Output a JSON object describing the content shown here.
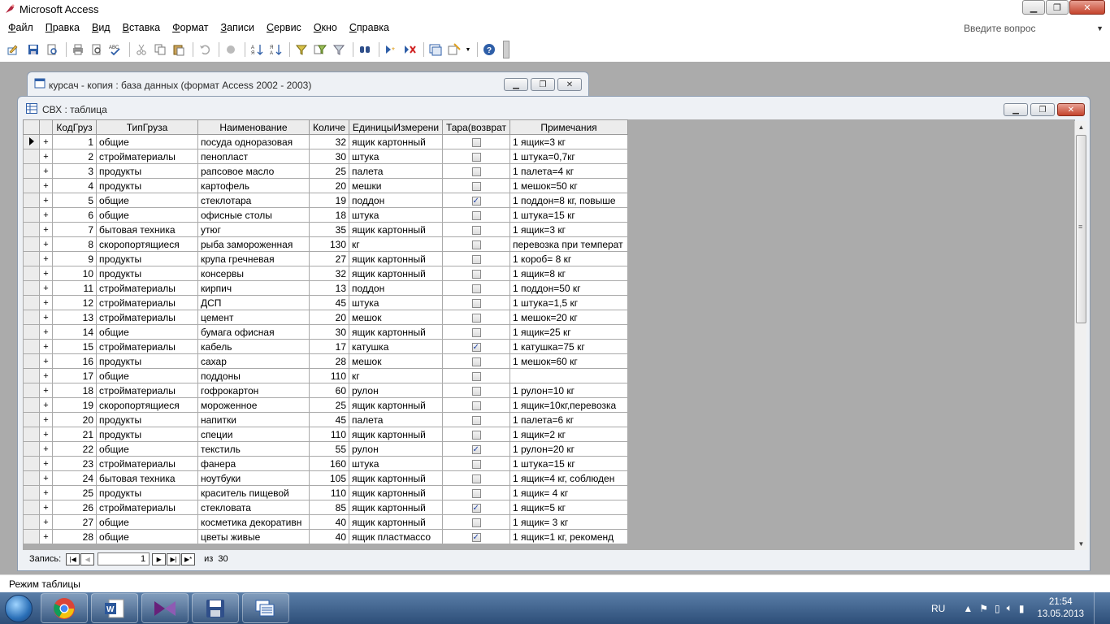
{
  "app": {
    "title": "Microsoft Access"
  },
  "menu": [
    "Файл",
    "Правка",
    "Вид",
    "Вставка",
    "Формат",
    "Записи",
    "Сервис",
    "Окно",
    "Справка"
  ],
  "ask": {
    "placeholder": "Введите вопрос"
  },
  "db_window": {
    "title": "курсач - копия : база данных (формат Access 2002 - 2003)"
  },
  "table_window": {
    "title": "СВХ : таблица"
  },
  "columns": [
    "КодГруз",
    "ТипГруза",
    "Наименование",
    "Количе",
    "ЕдиницыИзмерени",
    "Тара(возврат",
    "Примечания"
  ],
  "rows": [
    {
      "id": "1",
      "type": "общие",
      "name": "посуда одноразовая",
      "qty": "32",
      "unit": "ящик картонный",
      "tara": false,
      "note": "1 ящик=3 кг"
    },
    {
      "id": "2",
      "type": "стройматериалы",
      "name": "пенопласт",
      "qty": "30",
      "unit": "штука",
      "tara": false,
      "note": "1 штука=0,7кг"
    },
    {
      "id": "3",
      "type": "продукты",
      "name": "рапсовое масло",
      "qty": "25",
      "unit": "палета",
      "tara": false,
      "note": "1 палета=4 кг"
    },
    {
      "id": "4",
      "type": "продукты",
      "name": "картофель",
      "qty": "20",
      "unit": "мешки",
      "tara": false,
      "note": "1 мешок=50 кг"
    },
    {
      "id": "5",
      "type": "общие",
      "name": "стеклотара",
      "qty": "19",
      "unit": "поддон",
      "tara": true,
      "note": "1 поддон=8 кг, повыше"
    },
    {
      "id": "6",
      "type": "общие",
      "name": "офисные столы",
      "qty": "18",
      "unit": "штука",
      "tara": false,
      "note": "1 штука=15 кг"
    },
    {
      "id": "7",
      "type": "бытовая техника",
      "name": "утюг",
      "qty": "35",
      "unit": "ящик картонный",
      "tara": false,
      "note": "1 ящик=3 кг"
    },
    {
      "id": "8",
      "type": "скоропортящиеся",
      "name": "рыба замороженная",
      "qty": "130",
      "unit": "кг",
      "tara": false,
      "note": "перевозка при температ"
    },
    {
      "id": "9",
      "type": "продукты",
      "name": "крупа гречневая",
      "qty": "27",
      "unit": "ящик картонный",
      "tara": false,
      "note": "1 короб= 8 кг"
    },
    {
      "id": "10",
      "type": "продукты",
      "name": "консервы",
      "qty": "32",
      "unit": "ящик картонный",
      "tara": false,
      "note": "1 ящик=8 кг"
    },
    {
      "id": "11",
      "type": "стройматериалы",
      "name": "кирпич",
      "qty": "13",
      "unit": "поддон",
      "tara": false,
      "note": "1 поддон=50 кг"
    },
    {
      "id": "12",
      "type": "стройматериалы",
      "name": "ДСП",
      "qty": "45",
      "unit": "штука",
      "tara": false,
      "note": "1 штука=1,5 кг"
    },
    {
      "id": "13",
      "type": "стройматериалы",
      "name": "цемент",
      "qty": "20",
      "unit": "мешок",
      "tara": false,
      "note": "1 мешок=20 кг"
    },
    {
      "id": "14",
      "type": "общие",
      "name": "бумага офисная",
      "qty": "30",
      "unit": "ящик картонный",
      "tara": false,
      "note": "1 ящик=25 кг"
    },
    {
      "id": "15",
      "type": "стройматериалы",
      "name": "кабель",
      "qty": "17",
      "unit": "катушка",
      "tara": true,
      "note": "1 катушка=75 кг"
    },
    {
      "id": "16",
      "type": "продукты",
      "name": "сахар",
      "qty": "28",
      "unit": "мешок",
      "tara": false,
      "note": "1 мешок=60 кг"
    },
    {
      "id": "17",
      "type": "общие",
      "name": "поддоны",
      "qty": "110",
      "unit": "кг",
      "tara": false,
      "note": ""
    },
    {
      "id": "18",
      "type": "стройматериалы",
      "name": "гофрокартон",
      "qty": "60",
      "unit": "рулон",
      "tara": false,
      "note": "1 рулон=10 кг"
    },
    {
      "id": "19",
      "type": "скоропортящиеся",
      "name": "мороженное",
      "qty": "25",
      "unit": "ящик картонный",
      "tara": false,
      "note": "1 ящик=10кг,перевозка"
    },
    {
      "id": "20",
      "type": "продукты",
      "name": "напитки",
      "qty": "45",
      "unit": "палета",
      "tara": false,
      "note": "1 палета=6 кг"
    },
    {
      "id": "21",
      "type": "продукты",
      "name": "специи",
      "qty": "110",
      "unit": "ящик картонный",
      "tara": false,
      "note": "1 ящик=2 кг"
    },
    {
      "id": "22",
      "type": "общие",
      "name": "текстиль",
      "qty": "55",
      "unit": "рулон",
      "tara": true,
      "note": "1 рулон=20 кг"
    },
    {
      "id": "23",
      "type": "стройматериалы",
      "name": "фанера",
      "qty": "160",
      "unit": "штука",
      "tara": false,
      "note": "1 штука=15 кг"
    },
    {
      "id": "24",
      "type": "бытовая техника",
      "name": "ноутбуки",
      "qty": "105",
      "unit": "ящик картонный",
      "tara": false,
      "note": "1 ящик=4 кг, соблюден"
    },
    {
      "id": "25",
      "type": "продукты",
      "name": "краситель пищевой",
      "qty": "110",
      "unit": "ящик картонный",
      "tara": false,
      "note": "1 ящик= 4 кг"
    },
    {
      "id": "26",
      "type": "стройматериалы",
      "name": "стекловата",
      "qty": "85",
      "unit": "ящик картонный",
      "tara": true,
      "note": "1 ящик=5 кг"
    },
    {
      "id": "27",
      "type": "общие",
      "name": "косметика декоративн",
      "qty": "40",
      "unit": "ящик картонный",
      "tara": false,
      "note": "1 ящик= 3 кг"
    },
    {
      "id": "28",
      "type": "общие",
      "name": "цветы живые",
      "qty": "40",
      "unit": "ящик пластмассо",
      "tara": true,
      "note": "1 ящик=1 кг, рекоменд"
    }
  ],
  "navigation": {
    "label": "Запись:",
    "current": "1",
    "of_label": "из",
    "total": "30"
  },
  "status": {
    "text": "Режим таблицы"
  },
  "tray": {
    "lang": "RU",
    "time": "21:54",
    "date": "13.05.2013"
  }
}
